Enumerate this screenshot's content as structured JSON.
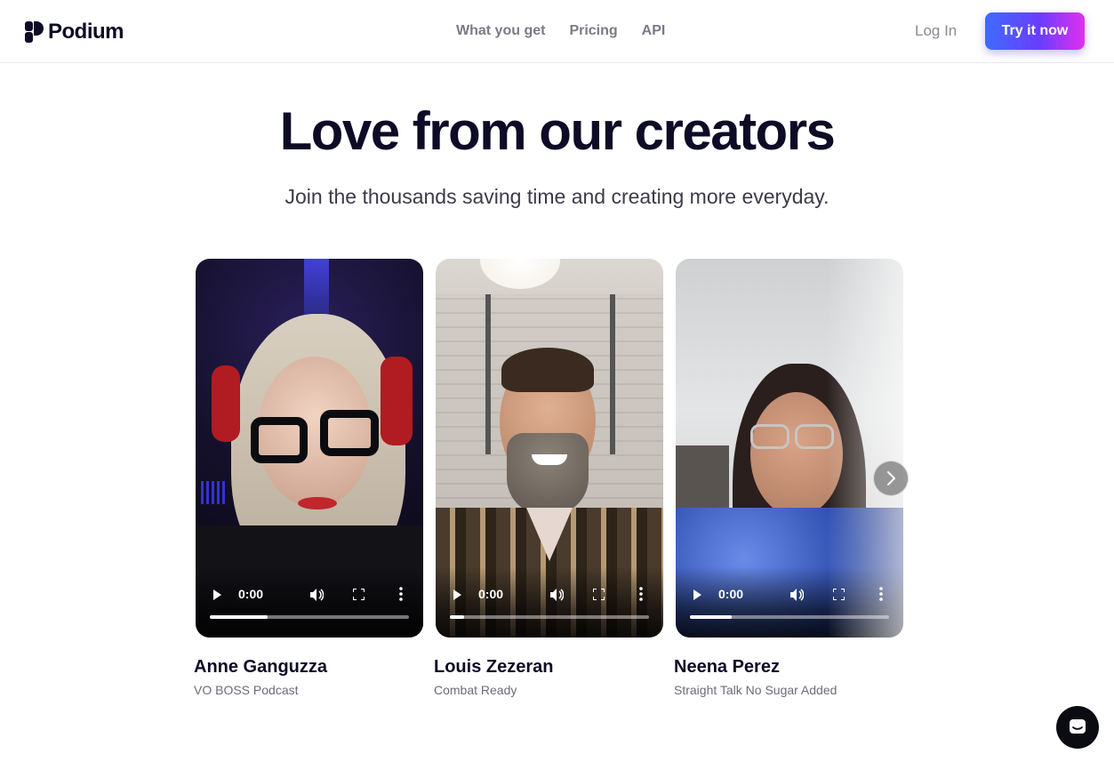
{
  "header": {
    "logo_text": "Podium",
    "nav": [
      "What you get",
      "Pricing",
      "API"
    ],
    "login_label": "Log In",
    "cta_label": "Try it now"
  },
  "hero": {
    "title": "Love from our creators",
    "subtitle": "Join the thousands saving time and creating more everyday."
  },
  "testimonials": [
    {
      "name": "Anne Ganguzza",
      "show": "VO BOSS Podcast",
      "time": "0:00",
      "progress_fraction": 0.29
    },
    {
      "name": "Louis Zezeran",
      "show": "Combat Ready",
      "time": "0:00",
      "progress_fraction": 0.07
    },
    {
      "name": "Neena Perez",
      "show": "Straight Talk No Sugar Added",
      "time": "0:00",
      "progress_fraction": 0.21
    }
  ],
  "colors": {
    "brand_dark": "#0d0b26",
    "cta_gradient_start": "#3e6bff",
    "cta_gradient_end": "#e32ff0"
  },
  "icons": {
    "next": "chevron-right-icon",
    "chat": "chat-bubble-icon",
    "play": "play-icon",
    "volume": "volume-icon",
    "fullscreen": "fullscreen-icon",
    "more": "more-vertical-icon"
  }
}
